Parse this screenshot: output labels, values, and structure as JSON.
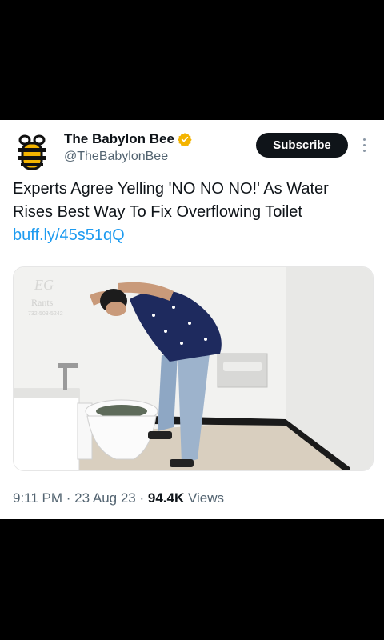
{
  "author": {
    "name": "The Babylon Bee",
    "handle": "@TheBabylonBee",
    "avatar_icon": "bee-logo-icon",
    "verified_icon": "verified-badge-icon",
    "verified_color": "#f4b400"
  },
  "actions": {
    "subscribe_label": "Subscribe",
    "more_icon": "more-vertical-icon"
  },
  "tweet": {
    "text": "Experts Agree Yelling 'NO NO NO!' As Water Rises Best Way To Fix Overflowing Toilet",
    "link": "buff.ly/45s51qQ"
  },
  "media": {
    "watermark_line1": "EG",
    "watermark_line2": "Rants",
    "watermark_line3": "732-503-5242"
  },
  "meta": {
    "time": "9:11 PM",
    "sep1": " · ",
    "date": "23 Aug 23",
    "sep2": " · ",
    "views_count": "94.4K",
    "views_label": " Views"
  },
  "colors": {
    "accent_link": "#1d9bf0",
    "secondary_text": "#536471",
    "button_bg": "#0f1419"
  }
}
